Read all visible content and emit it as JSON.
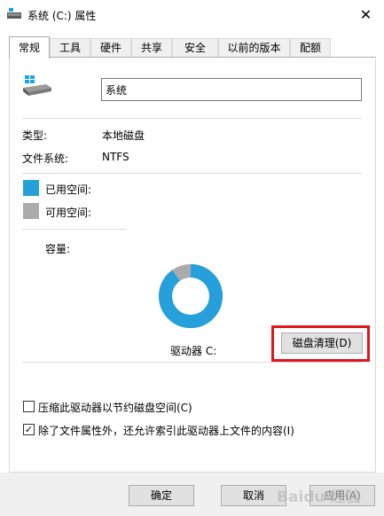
{
  "window": {
    "title": "系统 (C:) 属性",
    "close_glyph": "✕"
  },
  "tabs": [
    {
      "label": "常规",
      "active": true
    },
    {
      "label": "工具"
    },
    {
      "label": "硬件"
    },
    {
      "label": "共享"
    },
    {
      "label": "安全"
    },
    {
      "label": "以前的版本"
    },
    {
      "label": "配额"
    }
  ],
  "general": {
    "drive_name": "系统",
    "type_label": "类型:",
    "type_value": "本地磁盘",
    "fs_label": "文件系统:",
    "fs_value": "NTFS",
    "used_label": "已用空间:",
    "free_label": "可用空间:",
    "capacity_label": "容量:",
    "drive_label": "驱动器 C:",
    "cleanup_button": "磁盘清理(D)",
    "compress_label": "压缩此驱动器以节约磁盘空间(C)",
    "compress_checked": false,
    "index_label": "除了文件属性外，还允许索引此驱动器上文件的内容(I)",
    "index_checked": true
  },
  "usage": {
    "used_fraction": 0.9
  },
  "colors": {
    "used": "#26a0da",
    "free": "#ababab",
    "highlight": "#e1151b"
  },
  "footer": {
    "ok_label": "确定",
    "cancel_label": "取消",
    "apply_label": "应用(A)"
  },
  "watermark": {
    "text": "Baidu 经验"
  }
}
